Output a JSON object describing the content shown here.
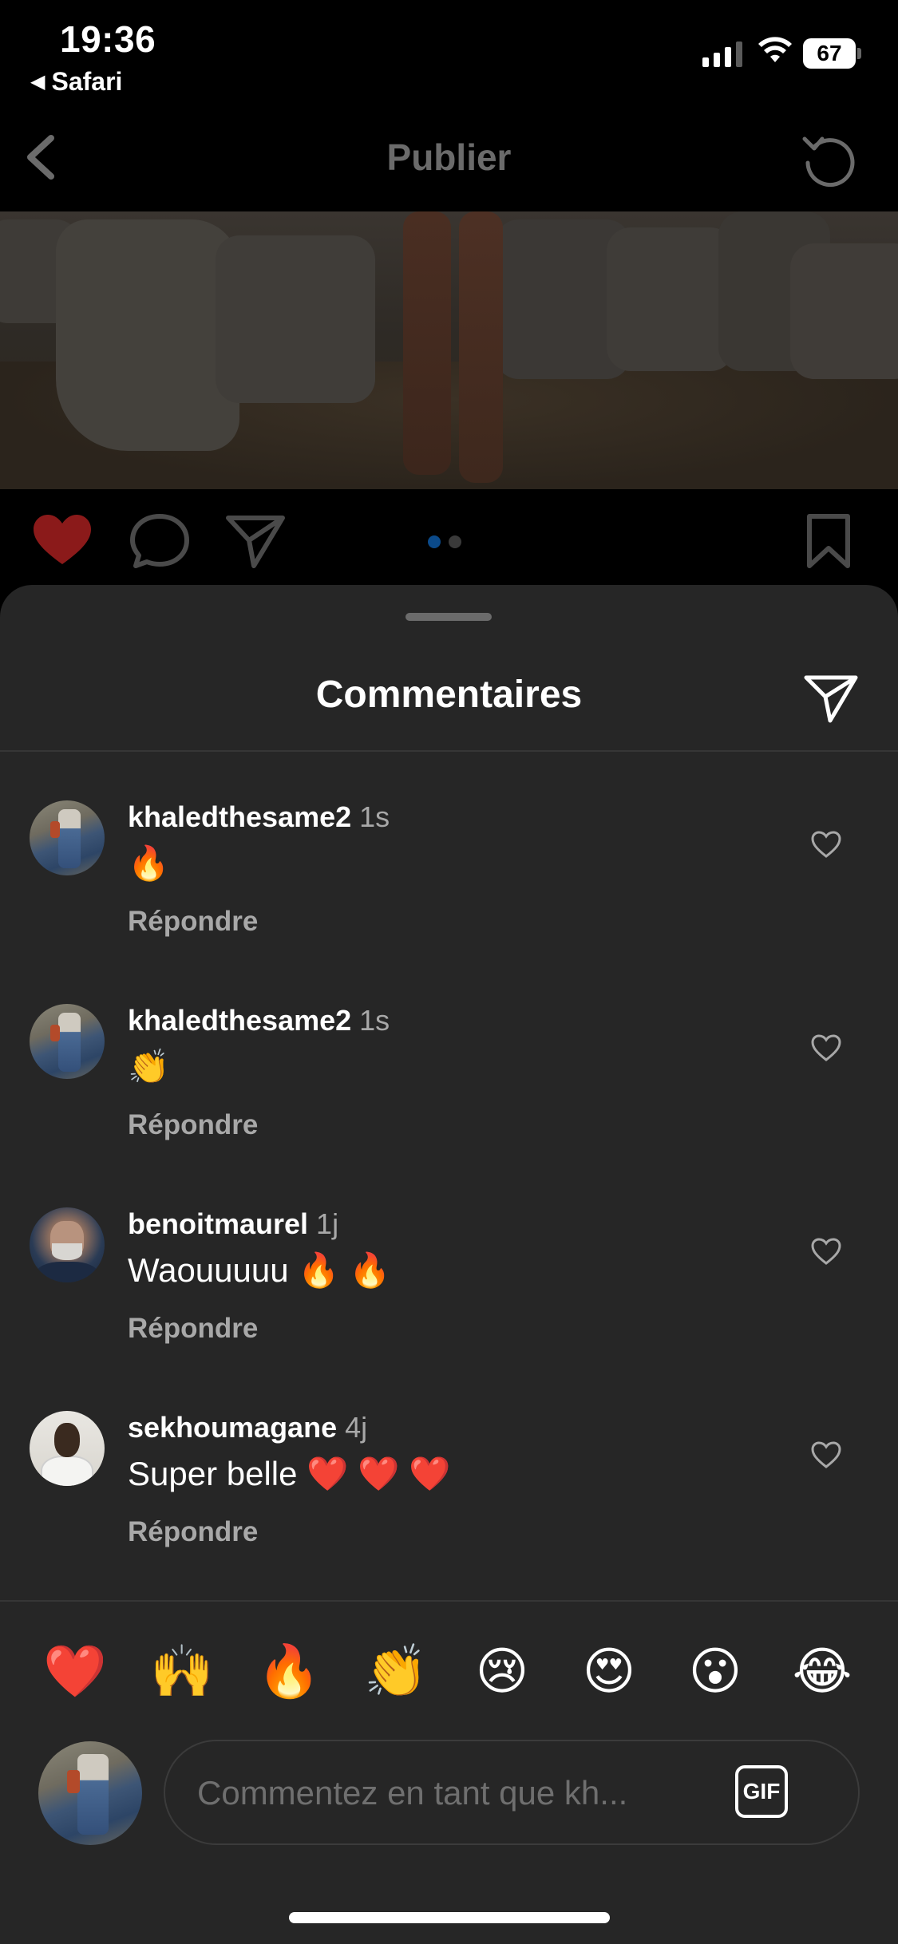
{
  "status_bar": {
    "time": "19:36",
    "back_app": "Safari",
    "battery": "67"
  },
  "nav": {
    "title": "Publier"
  },
  "actions": {
    "liked": true,
    "like_color": "#8b1a1a",
    "carousel_active_color": "#0b4a8a",
    "carousel_inactive_color": "#3a3a3a",
    "carousel_index": 1,
    "carousel_count": 2
  },
  "comments_sheet": {
    "title": "Commentaires",
    "comments": [
      {
        "username": "khaledthesame2",
        "time": "1s",
        "text": "🔥",
        "reply_label": "Répondre",
        "avatar": "jeans"
      },
      {
        "username": "khaledthesame2",
        "time": "1s",
        "text": "👏",
        "reply_label": "Répondre",
        "avatar": "jeans"
      },
      {
        "username": "benoitmaurel",
        "time": "1j",
        "text": "Waouuuuu 🔥 🔥",
        "reply_label": "Répondre",
        "avatar": "man"
      },
      {
        "username": "sekhoumagane",
        "time": "4j",
        "text": "Super belle ❤️ ❤️ ❤️",
        "reply_label": "Répondre",
        "avatar": "sek"
      }
    ]
  },
  "quick_emojis": [
    "❤️",
    "🙌",
    "🔥",
    "👏",
    "😢",
    "😍",
    "😮",
    "😂"
  ],
  "composer": {
    "placeholder": "Commentez en tant que kh...",
    "gif_label": "GIF"
  }
}
